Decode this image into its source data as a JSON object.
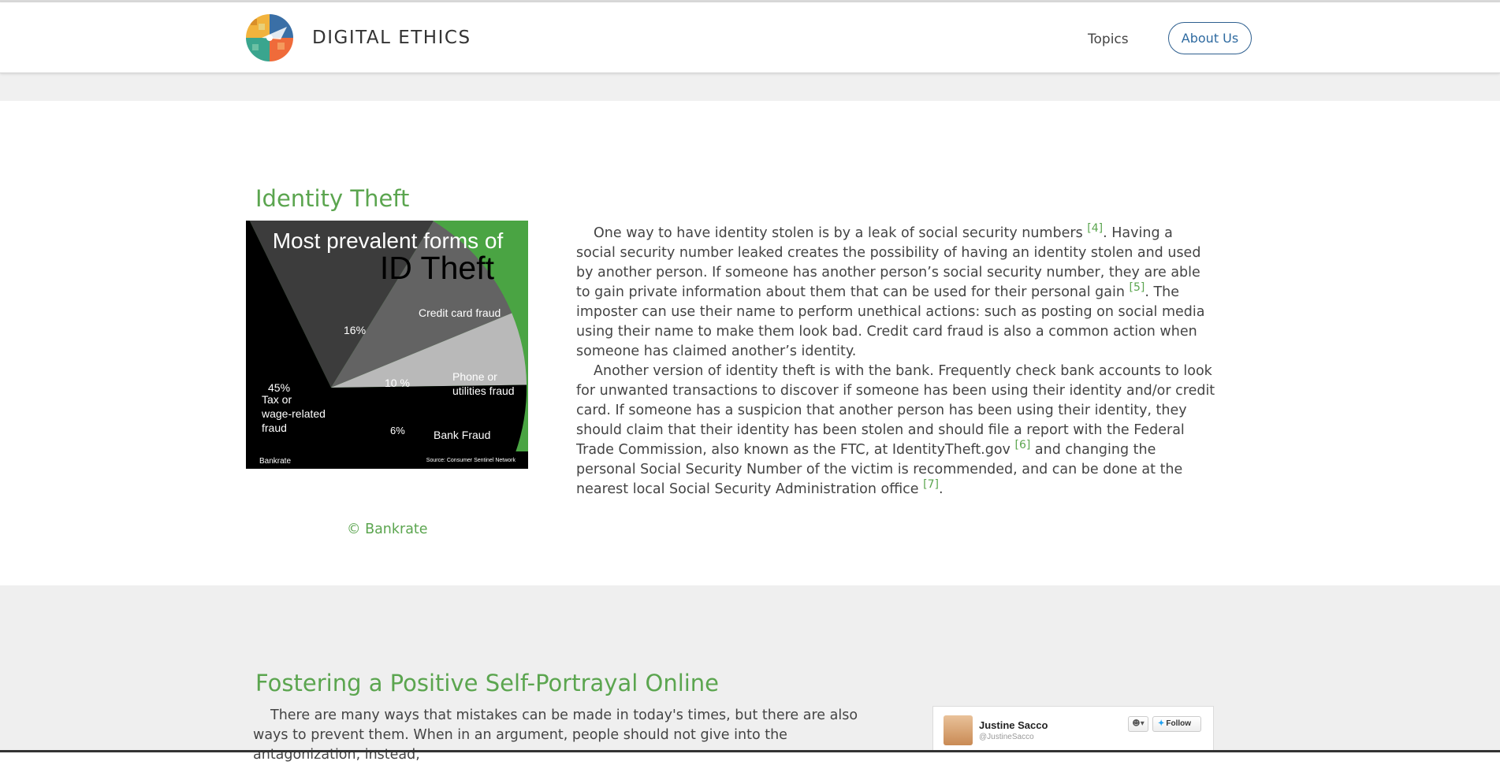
{
  "header": {
    "brand": "DIGITAL ETHICS",
    "nav": {
      "topics": "Topics",
      "about": "About Us"
    }
  },
  "section1": {
    "title": "Identity Theft",
    "image_credit": "© Bankrate",
    "chart_image": {
      "heading_line1": "Most prevalent forms of",
      "heading_line2": "ID Theft",
      "labels": {
        "credit": "Credit card fraud",
        "phone_1": "Phone or",
        "phone_2": "utilities fraud",
        "bank": "Bank Fraud",
        "tax_pct": "45%",
        "tax_1": "Tax or",
        "tax_2": "wage-related",
        "tax_3": "fraud",
        "pct_16": "16%",
        "pct_10": "10 %",
        "pct_6": "6%",
        "brand": "Bankrate",
        "source": "Source: Consumer Sentinel Network"
      }
    },
    "p1": {
      "a": "One way to have identity stolen is by a leak of social security numbers ",
      "c1": "[4]",
      "b": ". Having a social security number leaked creates the possibility of having an identity stolen and used by another person. If someone has another person’s social security number, they are able to gain private information about them that can be used for their personal gain ",
      "c2": "[5]",
      "c": ". The imposter can use their name to perform unethical actions: such as posting on social media using their name to make them look bad. Credit card fraud is also a common action when someone has claimed another’s identity."
    },
    "p2": {
      "a": "Another version of identity theft is with the bank. Frequently check bank accounts to look for unwanted transactions to discover if someone has been using their identity and/or credit card. If someone has a suspicion that another person has been using their identity, they should claim that their identity has been stolen and should file a report with the Federal Trade Commission, also known as the FTC, at IdentityTheft.gov ",
      "c1": "[6]",
      "b": " and changing the personal Social Security Number of the victim is recommended, and can be done at the nearest local Social Security Administration office ",
      "c2": "[7]",
      "c": "."
    }
  },
  "section2": {
    "title": "Fostering a Positive Self-Portrayal Online",
    "p1": "There are many ways that mistakes can be made in today's times, but there are also ways to prevent them. When in an argument, people should not give into the antagonization, instead,",
    "tweet": {
      "name": "Justine Sacco",
      "handle": "@JustineSacco",
      "follow": "Follow"
    }
  },
  "chart_data": {
    "type": "pie",
    "title": "Most prevalent forms of ID Theft",
    "categories": [
      "Tax or wage-related fraud",
      "Credit card fraud",
      "Phone or utilities fraud",
      "Bank Fraud"
    ],
    "values": [
      45,
      16,
      10,
      6
    ],
    "colors": [
      "#000000",
      "#3c3c3c",
      "#636363",
      "#b9b9b9"
    ],
    "background": "#4aa443"
  },
  "colors": {
    "accent_green": "#5ba54f",
    "button_blue": "#2e6aa0",
    "band_gray": "#efefef"
  }
}
